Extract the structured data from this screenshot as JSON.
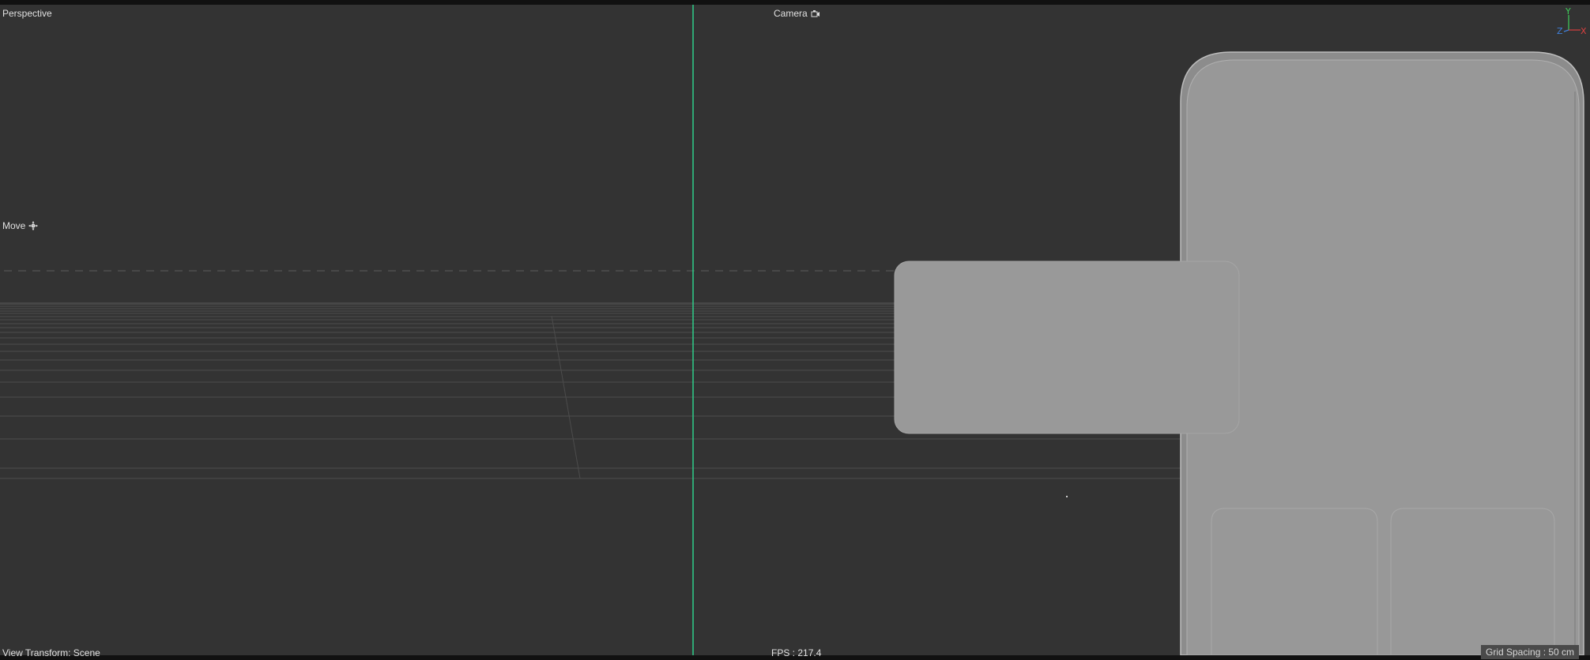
{
  "viewport": {
    "name": "Perspective",
    "camera_label": "Camera",
    "active_tool": "Move",
    "view_transform": "View Transform: Scene",
    "fps": "FPS : 217.4",
    "grid_spacing": "Grid Spacing : 50 cm"
  },
  "axis_gizmo": {
    "y": "Y",
    "z": "Z",
    "x": "X"
  },
  "colors": {
    "viewport_bg": "#333333",
    "object_fill": "#999999",
    "green_axis": "#2ecf8a",
    "axis_x": "#d94040",
    "axis_y": "#3fcf5a",
    "axis_z": "#3f7fd9"
  },
  "icons": [
    "camera-icon",
    "move-icon",
    "axis-gizmo-icon"
  ]
}
